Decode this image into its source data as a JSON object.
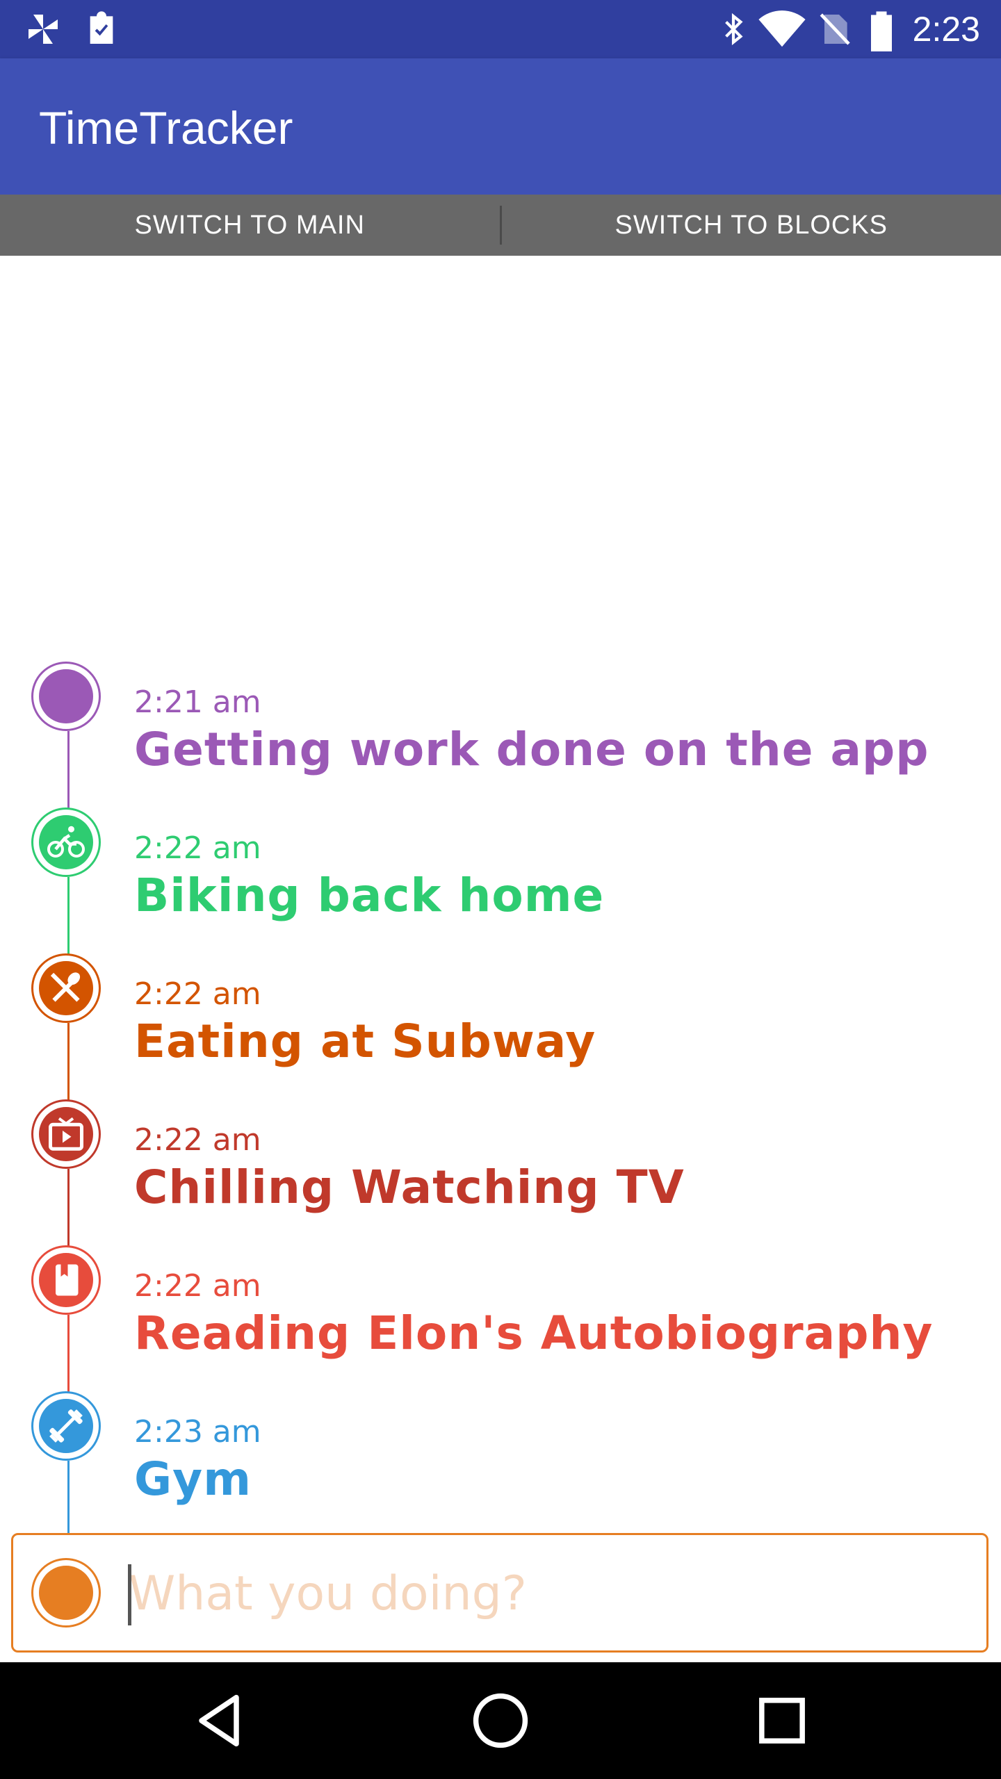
{
  "status_bar": {
    "time": "2:23",
    "icons": [
      "pinwheel-icon",
      "clipboard-check-icon",
      "bluetooth-icon",
      "wifi-icon",
      "no-sim-icon",
      "battery-icon"
    ]
  },
  "app_bar": {
    "title": "TimeTracker"
  },
  "switch_bar": {
    "main_label": "SWITCH TO MAIN",
    "blocks_label": "SWITCH TO BLOCKS"
  },
  "entries": [
    {
      "time": "2:21 am",
      "label": "Getting work done on the app",
      "color": "#9b59b6",
      "icon": "dot-icon"
    },
    {
      "time": "2:22 am",
      "label": "Biking back home",
      "color": "#2ecc71",
      "icon": "bike-icon"
    },
    {
      "time": "2:22 am",
      "label": "Eating at Subway",
      "color": "#d35400",
      "icon": "utensils-icon"
    },
    {
      "time": "2:22 am",
      "label": "Chilling Watching TV",
      "color": "#c0392b",
      "icon": "tv-icon"
    },
    {
      "time": "2:22 am",
      "label": "Reading Elon's Autobiography",
      "color": "#e74c3c",
      "icon": "book-icon"
    },
    {
      "time": "2:23 am",
      "label": "Gym",
      "color": "#3498db",
      "icon": "dumbbell-icon"
    }
  ],
  "input": {
    "placeholder": "What you doing?",
    "value": "",
    "color": "#e67e22"
  },
  "nav_bar": {
    "buttons": [
      "back-icon",
      "home-icon",
      "recents-icon"
    ]
  }
}
